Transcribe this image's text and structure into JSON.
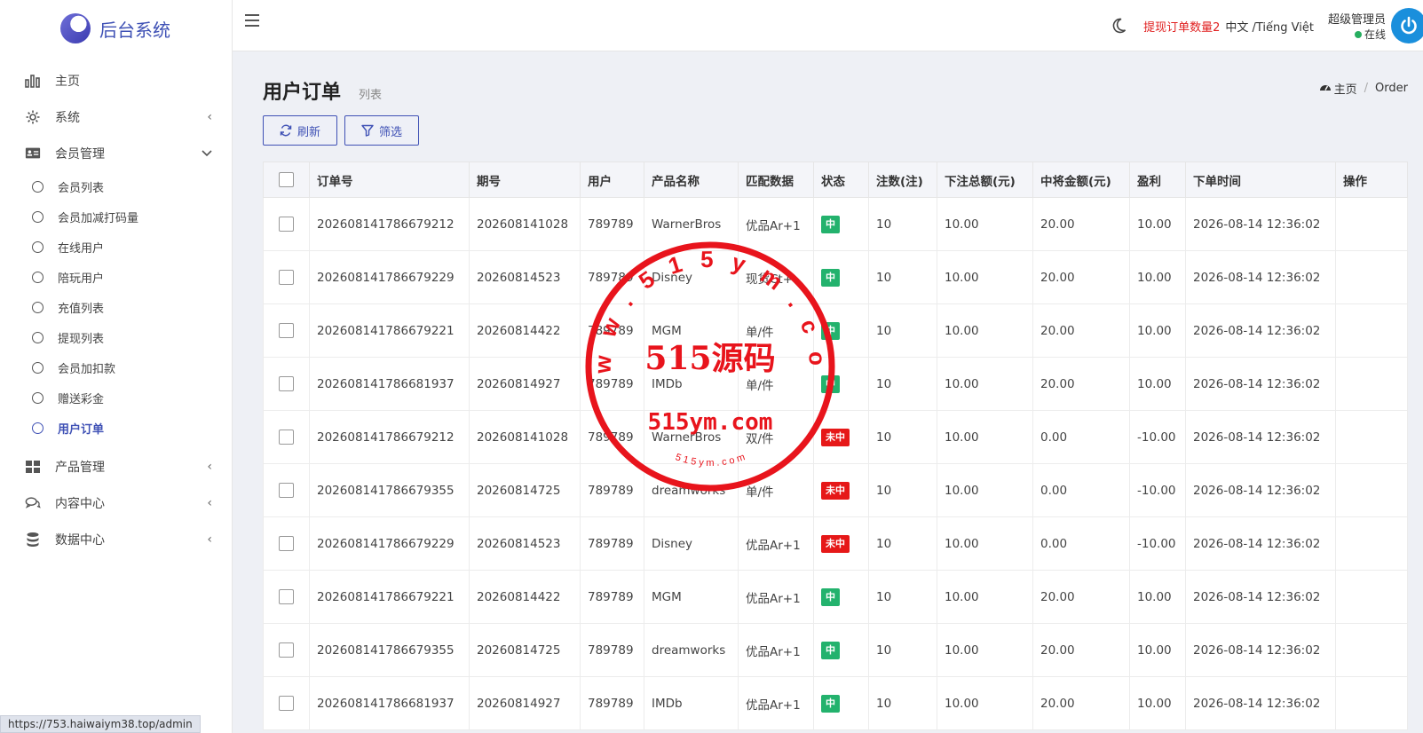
{
  "brand": {
    "name": "后台系统"
  },
  "sidebar": {
    "items": [
      {
        "label": "主页",
        "icon": "bar-chart-icon",
        "chevron": ""
      },
      {
        "label": "系统",
        "icon": "gear-icon",
        "chevron": "‹"
      },
      {
        "label": "会员管理",
        "icon": "id-card-icon",
        "chevron": "⌄"
      }
    ],
    "sub_items": [
      "会员列表",
      "会员加减打码量",
      "在线用户",
      "陪玩用户",
      "充值列表",
      "提现列表",
      "会员加扣款",
      "赠送彩金",
      "用户订单"
    ],
    "bottom_items": [
      {
        "label": "产品管理",
        "icon": "grid-icon"
      },
      {
        "label": "内容中心",
        "icon": "chat-icon"
      },
      {
        "label": "数据中心",
        "icon": "database-icon"
      }
    ]
  },
  "header": {
    "alert": "提现订单数量2",
    "lang": "中文 /Tiếng Việt",
    "admin_name": "超级管理员",
    "admin_status": "在线"
  },
  "page": {
    "title": "用户订单",
    "subtitle": "列表",
    "breadcrumb_home": "主页",
    "breadcrumb_current": "Order"
  },
  "toolbar": {
    "refresh": "刷新",
    "filter": "筛选"
  },
  "table": {
    "headers": [
      "订单号",
      "期号",
      "用户",
      "产品名称",
      "匹配数据",
      "状态",
      "注数(注)",
      "下注总额(元)",
      "中将金额(元)",
      "盈利",
      "下单时间",
      "操作"
    ],
    "rows": [
      [
        "202608141786679212",
        "202608141028",
        "789789",
        "WarnerBros",
        "优品Ar+1",
        "中",
        "10",
        "10.00",
        "20.00",
        "10.00",
        "2026-08-14 12:36:02"
      ],
      [
        "202608141786679229",
        "20260814523",
        "789789",
        "Disney",
        "现货Ct+",
        "中",
        "10",
        "10.00",
        "20.00",
        "10.00",
        "2026-08-14 12:36:02"
      ],
      [
        "202608141786679221",
        "20260814422",
        "789789",
        "MGM",
        "单/件",
        "中",
        "10",
        "10.00",
        "20.00",
        "10.00",
        "2026-08-14 12:36:02"
      ],
      [
        "202608141786681937",
        "20260814927",
        "789789",
        "IMDb",
        "单/件",
        "中",
        "10",
        "10.00",
        "20.00",
        "10.00",
        "2026-08-14 12:36:02"
      ],
      [
        "202608141786679212",
        "202608141028",
        "789789",
        "WarnerBros",
        "双/件",
        "未中",
        "10",
        "10.00",
        "0.00",
        "-10.00",
        "2026-08-14 12:36:02"
      ],
      [
        "202608141786679355",
        "20260814725",
        "789789",
        "dreamworks",
        "单/件",
        "未中",
        "10",
        "10.00",
        "0.00",
        "-10.00",
        "2026-08-14 12:36:02"
      ],
      [
        "202608141786679229",
        "20260814523",
        "789789",
        "Disney",
        "优品Ar+1",
        "未中",
        "10",
        "10.00",
        "0.00",
        "-10.00",
        "2026-08-14 12:36:02"
      ],
      [
        "202608141786679221",
        "20260814422",
        "789789",
        "MGM",
        "优品Ar+1",
        "中",
        "10",
        "10.00",
        "20.00",
        "10.00",
        "2026-08-14 12:36:02"
      ],
      [
        "202608141786679355",
        "20260814725",
        "789789",
        "dreamworks",
        "优品Ar+1",
        "中",
        "10",
        "10.00",
        "20.00",
        "10.00",
        "2026-08-14 12:36:02"
      ],
      [
        "202608141786681937",
        "20260814927",
        "789789",
        "IMDb",
        "优品Ar+1",
        "中",
        "10",
        "10.00",
        "20.00",
        "10.00",
        "2026-08-14 12:36:02"
      ]
    ]
  },
  "statusbar": {
    "url": "https://753.haiwaiym38.top/admin"
  },
  "watermark": {
    "big": "515源码",
    "domain": "515ym.com",
    "ring": "w w w . 5 1 5 y m . c o m",
    "small": "5 1 5 y m . c o m"
  },
  "colors": {
    "accent": "#3f51b5",
    "win": "#23b26d",
    "lose": "#e61818",
    "alert": "#e02020",
    "stamp": "#e8141c"
  }
}
